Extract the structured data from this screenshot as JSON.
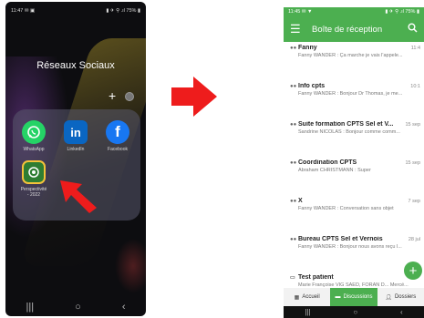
{
  "left_phone": {
    "status": {
      "time": "11:47",
      "left_icons": "✉ ▣",
      "right_icons": "▮ ✈ ⚲ .ıl 75% ▮"
    },
    "folder_title": "Réseaux Sociaux",
    "add_symbol": "+",
    "apps": [
      {
        "label": "WhatsApp",
        "color": "#25D366",
        "icon": "whatsapp-icon"
      },
      {
        "label": "LinkedIn",
        "color": "#0A66C2",
        "icon": "linkedin-icon"
      },
      {
        "label": "Facebook",
        "color": "#1877F2",
        "icon": "facebook-icon"
      },
      {
        "label": "Perspectivité\n- 2022",
        "color": "#2e7d32",
        "icon": "perspectivite-icon"
      }
    ],
    "nav": {
      "recents": "|||",
      "home": "○",
      "back": "‹"
    }
  },
  "right_phone": {
    "status": {
      "time": "11:45",
      "left_icons": "✉ ▼",
      "right_icons": "▮ ✈ ⚲ .ıl 75% ▮"
    },
    "appbar": {
      "title": "Boîte de réception",
      "menu_icon": "menu-icon",
      "search_icon": "search-icon"
    },
    "messages": [
      {
        "sender": "Fanny",
        "date": "11:4",
        "preview": "Fanny WANDER : Ça marche je vais l'appele..."
      },
      {
        "sender": "Info cpts",
        "date": "10:1",
        "preview": "Fanny WANDER : Bonjour Dr Thomas, je me..."
      },
      {
        "sender": "Suite formation CPTS Sel et V...",
        "date": "15 sep",
        "preview": "Sandrine NICOLAS : Bonjour comme comm..."
      },
      {
        "sender": "Coordination CPTS",
        "date": "15 sep",
        "preview": "Abraham CHRISTMANN : Super"
      },
      {
        "sender": "X",
        "date": "7 sep",
        "preview": "Fanny WANDER : Conversation sans objet"
      },
      {
        "sender": "Bureau CPTS Sel et Vernois",
        "date": "28 jul",
        "preview": "Fanny WANDER : Bonjour nous avons reçu l..."
      },
      {
        "sender": "Test patient",
        "date": "",
        "preview": "Marie Françoise VIG SAED, FORAN D... Mercé..."
      }
    ],
    "bottom_nav": [
      {
        "label": "Accueil",
        "icon": "grid-icon"
      },
      {
        "label": "Discussions",
        "icon": "chat-icon"
      },
      {
        "label": "Dossiers",
        "icon": "person-icon"
      }
    ],
    "fab_symbol": "+",
    "nav": {
      "recents": "|||",
      "home": "○",
      "back": "‹"
    }
  },
  "colors": {
    "accent_green": "#4caf50",
    "arrow_red": "#ee1c1c"
  }
}
